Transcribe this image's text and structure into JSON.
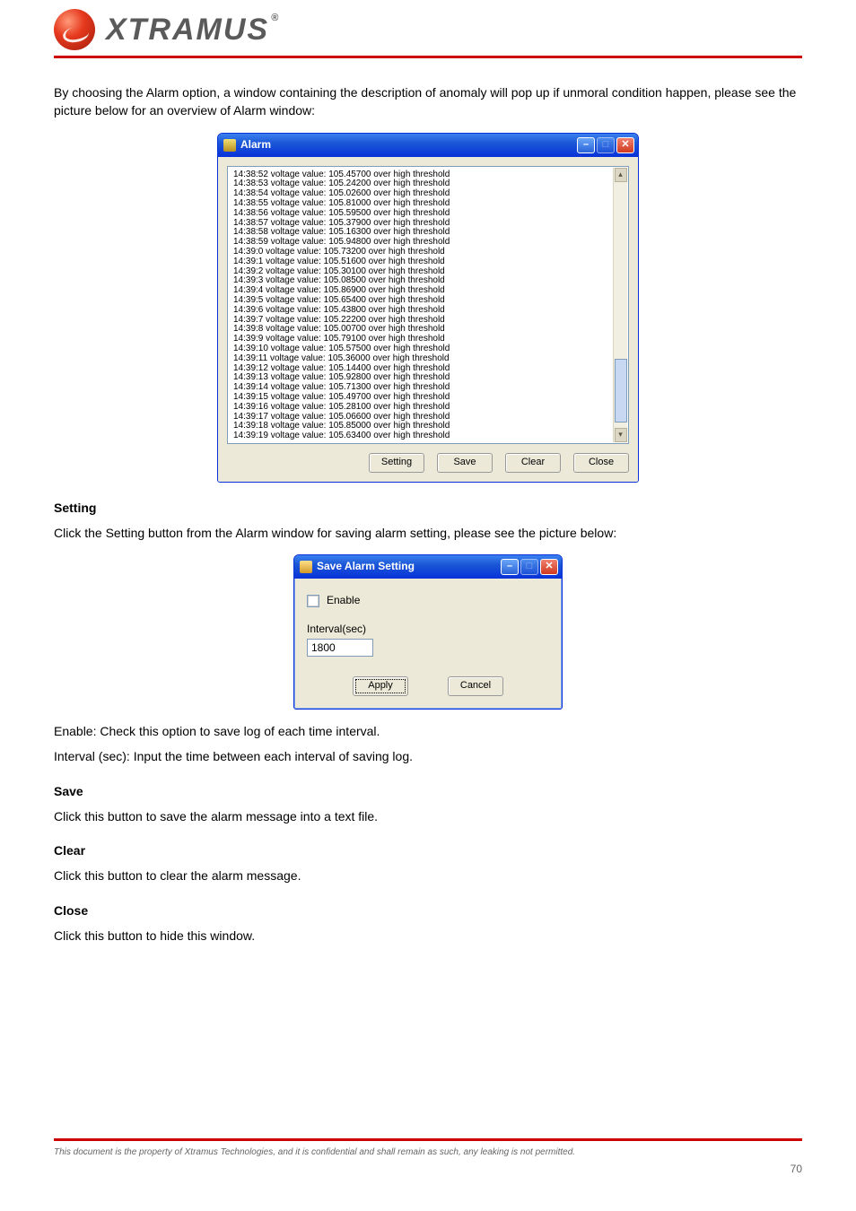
{
  "brand": "XTRAMUS",
  "brand_reg": "®",
  "intro": "By choosing the Alarm option, a window containing the description of anomaly will pop up if unmoral condition happen, please see the picture below for an overview of Alarm window:",
  "alarm_window": {
    "title": "Alarm",
    "buttons": {
      "setting": "Setting",
      "save": "Save",
      "clear": "Clear",
      "close": "Close"
    },
    "log": [
      "14:38:52 voltage value: 105.45700 over high threshold",
      "14:38:53 voltage value: 105.24200 over high threshold",
      "14:38:54 voltage value: 105.02600 over high threshold",
      "14:38:55 voltage value: 105.81000 over high threshold",
      "14:38:56 voltage value: 105.59500 over high threshold",
      "14:38:57 voltage value: 105.37900 over high threshold",
      "14:38:58 voltage value: 105.16300 over high threshold",
      "14:38:59 voltage value: 105.94800 over high threshold",
      "14:39:0 voltage value: 105.73200 over high threshold",
      "14:39:1 voltage value: 105.51600 over high threshold",
      "14:39:2 voltage value: 105.30100 over high threshold",
      "14:39:3 voltage value: 105.08500 over high threshold",
      "14:39:4 voltage value: 105.86900 over high threshold",
      "14:39:5 voltage value: 105.65400 over high threshold",
      "14:39:6 voltage value: 105.43800 over high threshold",
      "14:39:7 voltage value: 105.22200 over high threshold",
      "14:39:8 voltage value: 105.00700 over high threshold",
      "14:39:9 voltage value: 105.79100 over high threshold",
      "14:39:10 voltage value: 105.57500 over high threshold",
      "14:39:11 voltage value: 105.36000 over high threshold",
      "14:39:12 voltage value: 105.14400 over high threshold",
      "14:39:13 voltage value: 105.92800 over high threshold",
      "14:39:14 voltage value: 105.71300 over high threshold",
      "14:39:15 voltage value: 105.49700 over high threshold",
      "14:39:16 voltage value: 105.28100 over high threshold",
      "14:39:17 voltage value: 105.06600 over high threshold",
      "14:39:18 voltage value: 105.85000 over high threshold",
      "14:39:19 voltage value: 105.63400 over high threshold"
    ]
  },
  "setting_heading": "Setting",
  "setting_para": "Click the Setting button from the Alarm window for saving alarm setting, please see the picture below:",
  "save_window": {
    "title": "Save Alarm Setting",
    "enable_label": "Enable",
    "interval_label": "Interval(sec)",
    "interval_value": "1800",
    "apply": "Apply",
    "cancel": "Cancel"
  },
  "enable_para": "Enable: Check this option to save log of each time interval.",
  "interval_para": "Interval (sec): Input the time between each interval of saving log.",
  "save_heading": "Save",
  "save_para": "Click this button to save the alarm message into a text file.",
  "clear_heading": "Clear",
  "clear_para": "Click this button to clear the alarm message.",
  "close_heading": "Close",
  "close_para": "Click this button to hide this window.",
  "footer": "This document is the property of Xtramus Technologies, and it is confidential and shall remain as such, any leaking is not permitted.",
  "page": "70"
}
